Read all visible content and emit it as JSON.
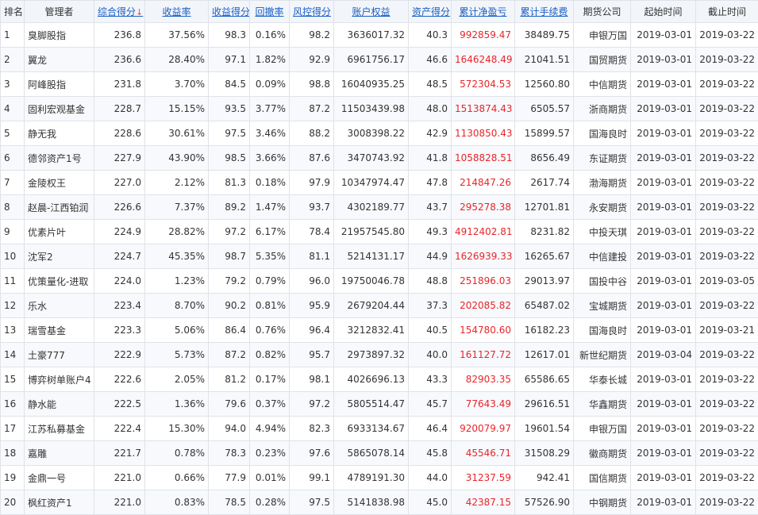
{
  "headers": [
    {
      "label": "排名",
      "sortable": false
    },
    {
      "label": "管理者",
      "sortable": false
    },
    {
      "label": "综合得分",
      "sortable": true,
      "arrow": "↓"
    },
    {
      "label": "收益率",
      "sortable": true
    },
    {
      "label": "收益得分",
      "sortable": true
    },
    {
      "label": "回撤率",
      "sortable": true
    },
    {
      "label": "风控得分",
      "sortable": true
    },
    {
      "label": "账户权益",
      "sortable": true
    },
    {
      "label": "资产得分",
      "sortable": true
    },
    {
      "label": "累计净盈亏",
      "sortable": true
    },
    {
      "label": "累计手续费",
      "sortable": true
    },
    {
      "label": "期货公司",
      "sortable": false
    },
    {
      "label": "起始时间",
      "sortable": false
    },
    {
      "label": "截止时间",
      "sortable": false
    }
  ],
  "rows": [
    [
      "1",
      "臭脚股指",
      "236.8",
      "37.56%",
      "98.3",
      "0.16%",
      "98.2",
      "3636017.32",
      "40.3",
      "992859.47",
      "38489.75",
      "申银万国",
      "2019-03-01",
      "2019-03-22"
    ],
    [
      "2",
      "翼龙",
      "236.6",
      "28.40%",
      "97.1",
      "1.82%",
      "92.9",
      "6961756.17",
      "46.6",
      "1646248.49",
      "21041.51",
      "国贸期货",
      "2019-03-01",
      "2019-03-22"
    ],
    [
      "3",
      "阿峰股指",
      "231.8",
      "3.70%",
      "84.5",
      "0.09%",
      "98.8",
      "16040935.25",
      "48.5",
      "572304.53",
      "12560.80",
      "中信期货",
      "2019-03-01",
      "2019-03-22"
    ],
    [
      "4",
      "固利宏观基金",
      "228.7",
      "15.15%",
      "93.5",
      "3.77%",
      "87.2",
      "11503439.98",
      "48.0",
      "1513874.43",
      "6505.57",
      "浙商期货",
      "2019-03-01",
      "2019-03-22"
    ],
    [
      "5",
      "静无我",
      "228.6",
      "30.61%",
      "97.5",
      "3.46%",
      "88.2",
      "3008398.22",
      "42.9",
      "1130850.43",
      "15899.57",
      "国海良时",
      "2019-03-01",
      "2019-03-22"
    ],
    [
      "6",
      "德邻资产1号",
      "227.9",
      "43.90%",
      "98.5",
      "3.66%",
      "87.6",
      "3470743.92",
      "41.8",
      "1058828.51",
      "8656.49",
      "东证期货",
      "2019-03-01",
      "2019-03-22"
    ],
    [
      "7",
      "金陵权王",
      "227.0",
      "2.12%",
      "81.3",
      "0.18%",
      "97.9",
      "10347974.47",
      "47.8",
      "214847.26",
      "2617.74",
      "渤海期货",
      "2019-03-01",
      "2019-03-22"
    ],
    [
      "8",
      "赵晨-江西铂润",
      "226.6",
      "7.37%",
      "89.2",
      "1.47%",
      "93.7",
      "4302189.77",
      "43.7",
      "295278.38",
      "12701.81",
      "永安期货",
      "2019-03-01",
      "2019-03-22"
    ],
    [
      "9",
      "优素片叶",
      "224.9",
      "28.82%",
      "97.2",
      "6.17%",
      "78.4",
      "21957545.80",
      "49.3",
      "4912402.81",
      "8231.82",
      "中投天琪",
      "2019-03-01",
      "2019-03-22"
    ],
    [
      "10",
      "沈军2",
      "224.7",
      "45.35%",
      "98.7",
      "5.35%",
      "81.1",
      "5214131.17",
      "44.9",
      "1626939.33",
      "16265.67",
      "中信建投",
      "2019-03-01",
      "2019-03-22"
    ],
    [
      "11",
      "优策量化-进取",
      "224.0",
      "1.23%",
      "79.2",
      "0.79%",
      "96.0",
      "19750046.78",
      "48.8",
      "251896.03",
      "29013.97",
      "国投中谷",
      "2019-03-01",
      "2019-03-05"
    ],
    [
      "12",
      "乐水",
      "223.4",
      "8.70%",
      "90.2",
      "0.81%",
      "95.9",
      "2679204.44",
      "37.3",
      "202085.82",
      "65487.02",
      "宝城期货",
      "2019-03-01",
      "2019-03-22"
    ],
    [
      "13",
      "瑞雪基金",
      "223.3",
      "5.06%",
      "86.4",
      "0.76%",
      "96.4",
      "3212832.41",
      "40.5",
      "154780.60",
      "16182.23",
      "国海良时",
      "2019-03-01",
      "2019-03-21"
    ],
    [
      "14",
      "土豪777",
      "222.9",
      "5.73%",
      "87.2",
      "0.82%",
      "95.7",
      "2973897.32",
      "40.0",
      "161127.72",
      "12617.01",
      "新世纪期货",
      "2019-03-04",
      "2019-03-22"
    ],
    [
      "15",
      "博弈树单账户4",
      "222.6",
      "2.05%",
      "81.2",
      "0.17%",
      "98.1",
      "4026696.13",
      "43.3",
      "82903.35",
      "65586.65",
      "华泰长城",
      "2019-03-01",
      "2019-03-22"
    ],
    [
      "16",
      "静水能",
      "222.5",
      "1.36%",
      "79.6",
      "0.37%",
      "97.2",
      "5805514.47",
      "45.7",
      "77643.49",
      "29616.51",
      "华鑫期货",
      "2019-03-01",
      "2019-03-22"
    ],
    [
      "17",
      "江苏私募基金",
      "222.4",
      "15.30%",
      "94.0",
      "4.94%",
      "82.3",
      "6933134.67",
      "46.4",
      "920079.97",
      "19601.54",
      "申银万国",
      "2019-03-01",
      "2019-03-22"
    ],
    [
      "18",
      "嘉雕",
      "221.7",
      "0.78%",
      "78.3",
      "0.23%",
      "97.6",
      "5865078.14",
      "45.8",
      "45546.71",
      "31508.29",
      "徽商期货",
      "2019-03-01",
      "2019-03-22"
    ],
    [
      "19",
      "金鼎一号",
      "221.0",
      "0.66%",
      "77.9",
      "0.01%",
      "99.1",
      "4789191.30",
      "44.0",
      "31237.59",
      "942.41",
      "国信期货",
      "2019-03-01",
      "2019-03-22"
    ],
    [
      "20",
      "枫红资产1",
      "221.0",
      "0.83%",
      "78.5",
      "0.28%",
      "97.5",
      "5141838.98",
      "45.0",
      "42387.15",
      "57526.90",
      "中钢期货",
      "2019-03-01",
      "2019-03-22"
    ]
  ],
  "colors": {
    "link": "#1a5fc4",
    "profit": "#e8252b",
    "sort_arrow": "#e84c3d"
  }
}
